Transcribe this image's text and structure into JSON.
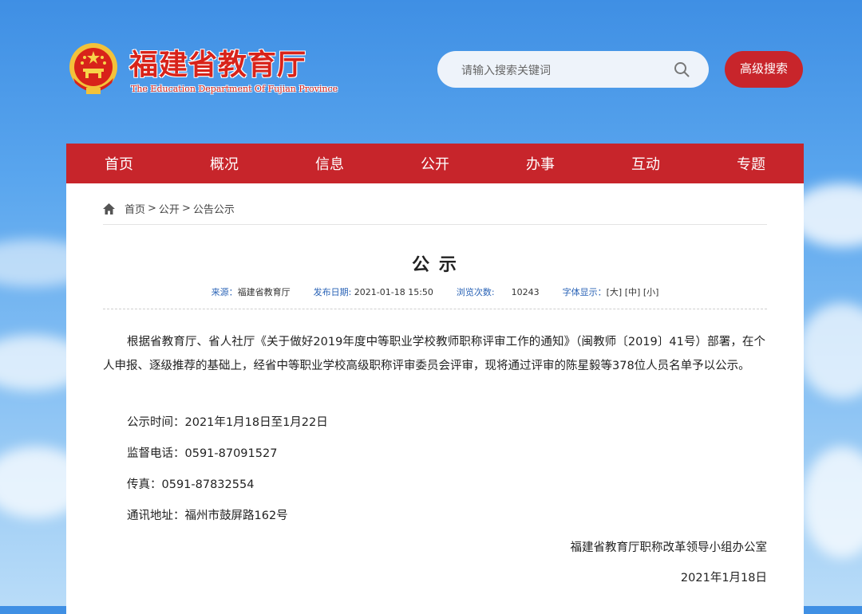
{
  "header": {
    "site_title": "福建省教育厅",
    "site_subtitle": "The Education Department Of Fujian Province",
    "search_placeholder": "请输入搜索关键词",
    "advanced_search_label": "高级搜索"
  },
  "nav": [
    "首页",
    "概况",
    "信息",
    "公开",
    "办事",
    "互动",
    "专题"
  ],
  "breadcrumb": {
    "items": [
      "首页",
      "公开",
      "公告公示"
    ],
    "separator": ">"
  },
  "article": {
    "title": "公 示",
    "meta": {
      "source_label": "来源：",
      "source": "福建省教育厅",
      "date_label": "发布日期:",
      "date": "2021-01-18 15:50",
      "views_label": "浏览次数:",
      "views": "10243",
      "font_label": "字体显示：",
      "font_large": "[大]",
      "font_medium": "[中]",
      "font_small": "[小]"
    },
    "paragraph": "根据省教育厅、省人社厅《关于做好2019年度中等职业学校教师职称评审工作的通知》（闽教师〔2019〕41号）部署，在个人申报、逐级推荐的基础上，经省中等职业学校高级职称评审委员会评审，现将通过评审的陈星毅等378位人员名单予以公示。",
    "period": "公示时间：2021年1月18日至1月22日",
    "phone": "监督电话：0591-87091527",
    "fax": "传真：0591-87832554",
    "address": "通讯地址：福州市鼓屏路162号",
    "signature": "福建省教育厅职称改革领导小组办公室",
    "sign_date": "2021年1月18日"
  },
  "colors": {
    "primary_red": "#c7252b",
    "link_blue": "#2a63b6"
  }
}
